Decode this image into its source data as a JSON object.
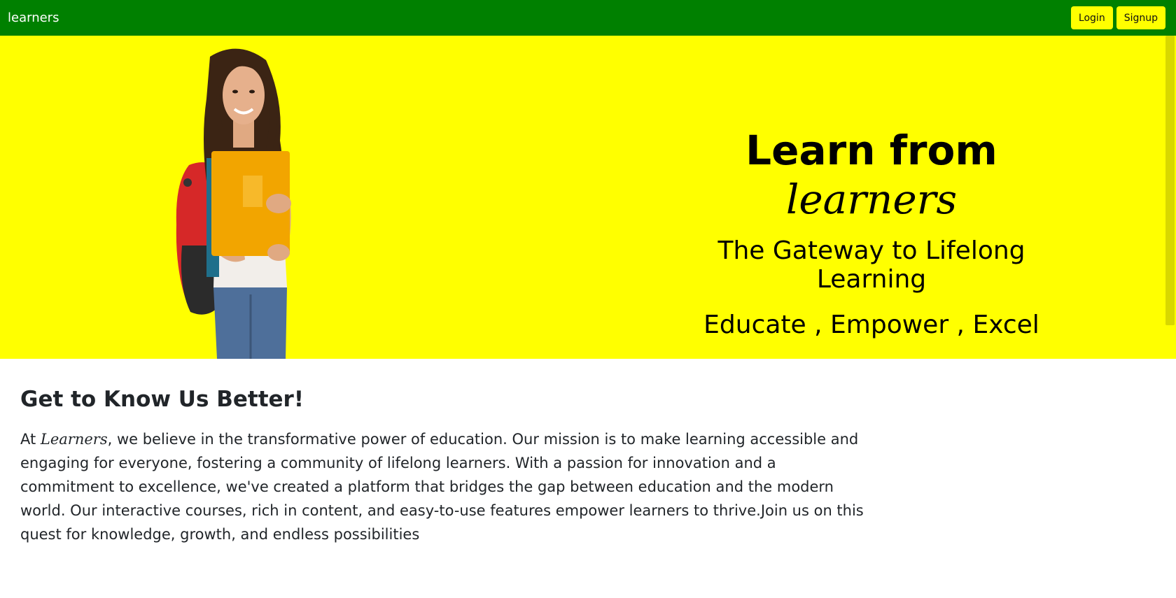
{
  "navbar": {
    "brand": "learners",
    "login_label": "Login",
    "signup_label": "Signup",
    "color": "#008000"
  },
  "hero": {
    "background": "#ffff00",
    "title_prefix": "Learn from",
    "title_script": "learners",
    "subtitle": "The Gateway to Lifelong Learning",
    "tagline": "Educate , Empower , Excel",
    "image": "student-with-books-and-backpack"
  },
  "about": {
    "title": "Get to Know Us Better!",
    "text_prefix": "At ",
    "text_script": "Learners",
    "text_body": ", we believe in the transformative power of education. Our mission is to make learning accessible and engaging for everyone, fostering a community of lifelong learners. With a passion for innovation and a commitment to excellence, we've created a platform that bridges the gap between education and the modern world. Our interactive courses, rich in content, and easy-to-use features empower learners to thrive.Join us on this quest for knowledge, growth, and endless possibilities"
  }
}
